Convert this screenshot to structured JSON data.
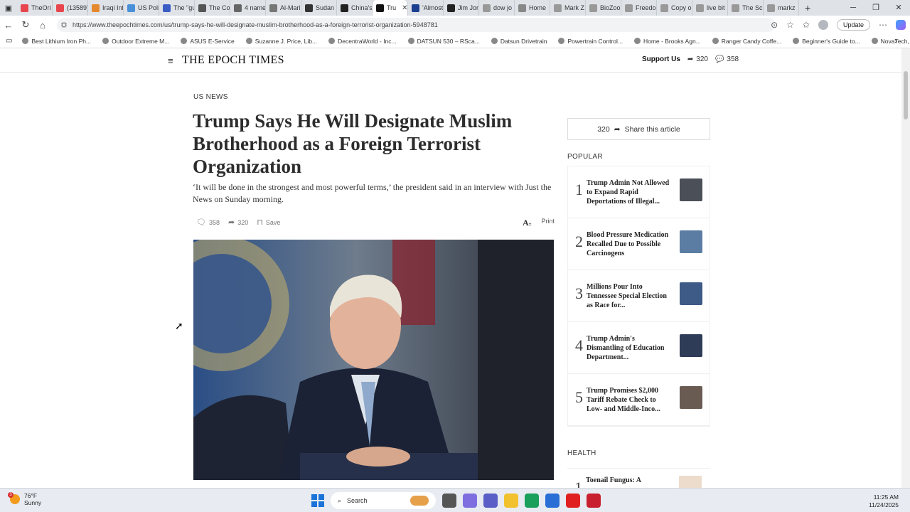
{
  "browser": {
    "tabs": [
      {
        "label": "TheOri",
        "color": "#e8464e"
      },
      {
        "label": "(13589)",
        "color": "#e8464e"
      },
      {
        "label": "Iraqi Inf",
        "color": "#e5892e"
      },
      {
        "label": "US Poli",
        "color": "#4a90d9"
      },
      {
        "label": "The \"gu",
        "color": "#3b5cc4"
      },
      {
        "label": "The Co",
        "color": "#555555"
      },
      {
        "label": "4 name",
        "color": "#666666"
      },
      {
        "label": "Al-Mari",
        "color": "#777777"
      },
      {
        "label": "Sudan",
        "color": "#333333"
      },
      {
        "label": "China's",
        "color": "#222222"
      },
      {
        "label": "Tru",
        "color": "#111111",
        "active": true
      },
      {
        "label": "'Almost",
        "color": "#1d3f8f"
      },
      {
        "label": "Jim Jor",
        "color": "#222222"
      },
      {
        "label": "dow jo",
        "color": "#999999"
      },
      {
        "label": "Home",
        "color": "#888888"
      },
      {
        "label": "Mark Z",
        "color": "#999999"
      },
      {
        "label": "BioZoo",
        "color": "#999999"
      },
      {
        "label": "Freedo",
        "color": "#999999"
      },
      {
        "label": "Copy o",
        "color": "#999999"
      },
      {
        "label": "live bit",
        "color": "#999999"
      },
      {
        "label": "The Sci",
        "color": "#999999"
      },
      {
        "label": "markz",
        "color": "#999999"
      }
    ],
    "tab_close": "✕",
    "new_tab": "+",
    "url": "https://www.theepochtimes.com/us/trump-says-he-will-designate-muslim-brotherhood-as-a-foreign-terrorist-organization-5948781",
    "update_label": "Update",
    "bookmarks": [
      "Best Lithium Iron Ph...",
      "Outdoor Extreme M...",
      "ASUS E-Service",
      "Suzanne J. Price, Lib...",
      "DecentraWorld - Inc...",
      "DATSUN 530 – RSca...",
      "Datsun Drivetrain",
      "Powertrain Control...",
      "Home - Brooks Agn...",
      "Ranger Candy Coffe...",
      "Beginner's Guide to...",
      "NovaTech, LTD - Sin..."
    ]
  },
  "site": {
    "logo": "THE EPOCH TIMES",
    "support_label": "Support Us",
    "share_count": "320",
    "comment_count": "358"
  },
  "article": {
    "section": "US NEWS",
    "headline": "Trump Says He Will Designate Muslim Brotherhood as a Foreign Terrorist Organization",
    "subhead": "‘It will be done in the strongest and most powerful terms,’ the president said in an interview with Just the News on Sunday morning.",
    "comments": "358",
    "shares": "320",
    "save_label": "Save",
    "font_label": "A",
    "print_label": "Print"
  },
  "sidebar": {
    "share_count": "320",
    "share_label": "Share this article",
    "popular_heading": "POPULAR",
    "popular": [
      {
        "num": "1",
        "title": "Trump Admin Not Allowed to Expand Rapid Deportations of Illegal...",
        "thumb": "#4b4f58"
      },
      {
        "num": "2",
        "title": "Blood Pressure Medication Recalled Due to Possible Carcinogens",
        "thumb": "#5b7da3"
      },
      {
        "num": "3",
        "title": "Millions Pour Into Tennessee Special Election as Race for...",
        "thumb": "#3e5a86"
      },
      {
        "num": "4",
        "title": "Trump Admin's Dismantling of Education Department...",
        "thumb": "#2f3c57"
      },
      {
        "num": "5",
        "title": "Trump Promises $2,000 Tariff Rebate Check to Low- and Middle-Inco...",
        "thumb": "#6a5b52"
      }
    ],
    "health_heading": "HEALTH",
    "health_first": {
      "num": "1",
      "title": "Toenail Fungus: A"
    }
  },
  "taskbar": {
    "weather_badge": "3",
    "temperature": "76°F",
    "condition": "Sunny",
    "search_label": "Search",
    "time": "11:25 AM",
    "date": "11/24/2025",
    "apps": [
      {
        "name": "task-view",
        "color": "#555555"
      },
      {
        "name": "copilot",
        "color": "#7f6ee0"
      },
      {
        "name": "teams",
        "color": "#5a5fc7"
      },
      {
        "name": "file-explorer",
        "color": "#f2c12e"
      },
      {
        "name": "edge",
        "color": "#1aa05a"
      },
      {
        "name": "store",
        "color": "#2a6fd6"
      },
      {
        "name": "youtube",
        "color": "#e02020"
      },
      {
        "name": "shield",
        "color": "#c8202e"
      }
    ]
  }
}
